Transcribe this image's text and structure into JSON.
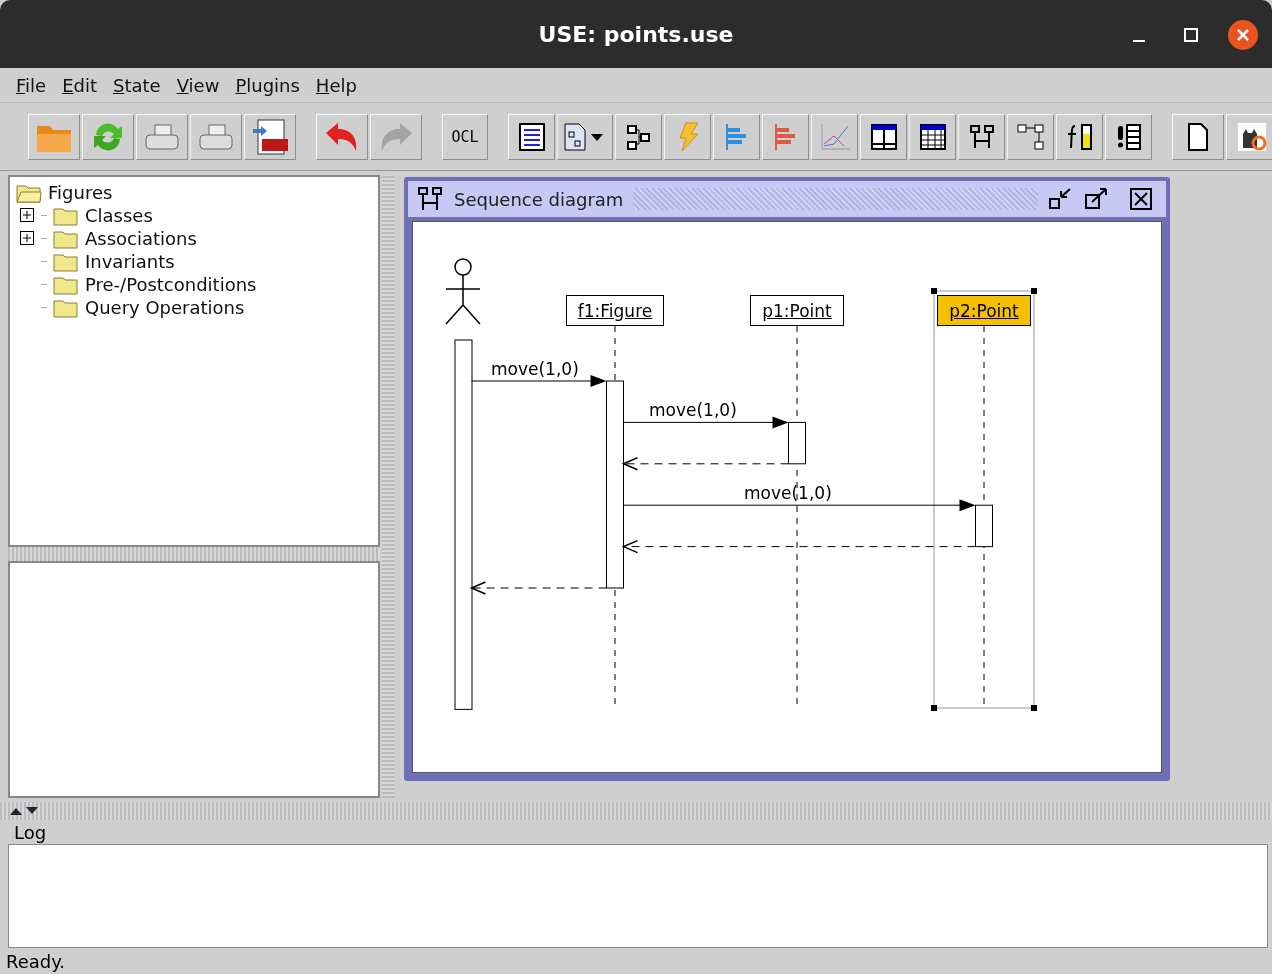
{
  "window": {
    "title": "USE: points.use"
  },
  "menu": [
    {
      "label": "File"
    },
    {
      "label": "Edit"
    },
    {
      "label": "State"
    },
    {
      "label": "View"
    },
    {
      "label": "Plugins"
    },
    {
      "label": "Help"
    }
  ],
  "toolbar": [
    [
      {
        "kind": "folder"
      },
      {
        "kind": "reload"
      },
      {
        "kind": "printer"
      },
      {
        "kind": "printer"
      },
      {
        "kind": "pdf"
      }
    ],
    [
      {
        "kind": "undo",
        "disabled": false
      },
      {
        "kind": "redo",
        "disabled": true
      }
    ],
    [
      {
        "kind": "text",
        "label": "OCL"
      }
    ],
    [
      {
        "kind": "list"
      },
      {
        "kind": "diagram-menu"
      },
      {
        "kind": "class-diagram"
      },
      {
        "kind": "lightning"
      },
      {
        "kind": "bars-blue"
      },
      {
        "kind": "bars-red"
      },
      {
        "kind": "line-chart"
      },
      {
        "kind": "split-table"
      },
      {
        "kind": "table"
      },
      {
        "kind": "sequence"
      },
      {
        "kind": "communication"
      },
      {
        "kind": "function"
      },
      {
        "kind": "exclaim-list"
      }
    ],
    [
      {
        "kind": "page"
      },
      {
        "kind": "cat"
      }
    ]
  ],
  "tree": {
    "label": "Figures",
    "children": [
      {
        "label": "Classes",
        "expanded": false
      },
      {
        "label": "Associations",
        "expanded": false
      },
      {
        "label": "Invariants"
      },
      {
        "label": "Pre-/Postconditions"
      },
      {
        "label": "Query Operations"
      }
    ]
  },
  "frame": {
    "title": "Sequence diagram"
  },
  "diagram": {
    "objects": [
      {
        "label": "f1:Figure",
        "selected": false
      },
      {
        "label": "p1:Point",
        "selected": false
      },
      {
        "label": "p2:Point",
        "selected": true
      }
    ],
    "messages": [
      {
        "kind": "call",
        "label": "move(1,0)"
      },
      {
        "kind": "call",
        "label": "move(1,0)"
      },
      {
        "kind": "return"
      },
      {
        "kind": "call",
        "label": "move(1,0)"
      },
      {
        "kind": "return"
      },
      {
        "kind": "return"
      }
    ]
  },
  "log": {
    "label": "Log"
  },
  "status_bar": "Ready."
}
